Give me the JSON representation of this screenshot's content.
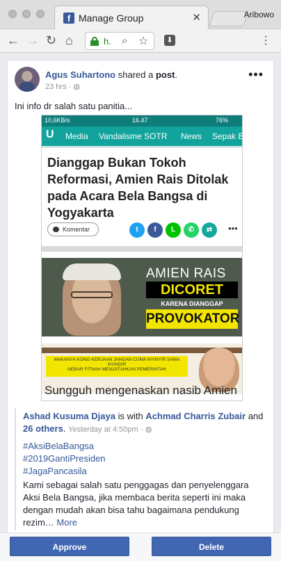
{
  "browser": {
    "tab_title": "Manage Group",
    "tab_close": "✕",
    "profile_name": "Aribowo",
    "url_text": "h.",
    "favicon_letter": "f"
  },
  "post": {
    "author": "Agus Suhartono",
    "action_text": "shared a",
    "object_text": "post",
    "period": ".",
    "time": "23 hrs",
    "body": "Ini info dr salah satu panitia..."
  },
  "screenshot": {
    "status_left": "10,6KB/s",
    "status_time": "16.47",
    "status_right": "76%",
    "app_logo": "U",
    "nav_items": [
      "Media",
      "Vandalisme SOTR",
      "News",
      "Sepak B"
    ],
    "headline": "Dianggap Bukan Tokoh Reformasi, Amien Rais Ditolak pada Acara Bela Bangsa di Yogyakarta",
    "komentar": "Komentar",
    "banner_line1": "AMIEN RAIS",
    "banner_line2": "DICORET",
    "banner_line3": "KARENA DIANGGAP",
    "banner_line4": "PROVOKATOR",
    "banner2_text1": "MAKANYA KONG KERJAAN JANGAN CUMA NYINYIR SAMA NYINDIR",
    "banner2_text2": "NEBAR FITNAH MENJATUHKAN PEMERINTAH",
    "caption": "Sungguh mengenaskan nasib Amien"
  },
  "shared": {
    "author": "Ashad Kusuma Djaya",
    "is_with": "is with",
    "with_name": "Achmad Charris Zubair",
    "and": "and",
    "others": "26 others",
    "period": ".",
    "time": "Yesterday at 4:50pm",
    "hashtags": [
      "#AksiBelaBangsa",
      "#2019GantiPresiden",
      "#JagaPancasila"
    ],
    "body": "Kami sebagai salah satu penggagas dan penyelenggara Aksi Bela Bangsa, jika membaca berita seperti ini maka dengan mudah akan bisa tahu bagaimana pendukung rezim…",
    "more": "More"
  },
  "actions": {
    "approve": "Approve",
    "delete": "Delete"
  }
}
